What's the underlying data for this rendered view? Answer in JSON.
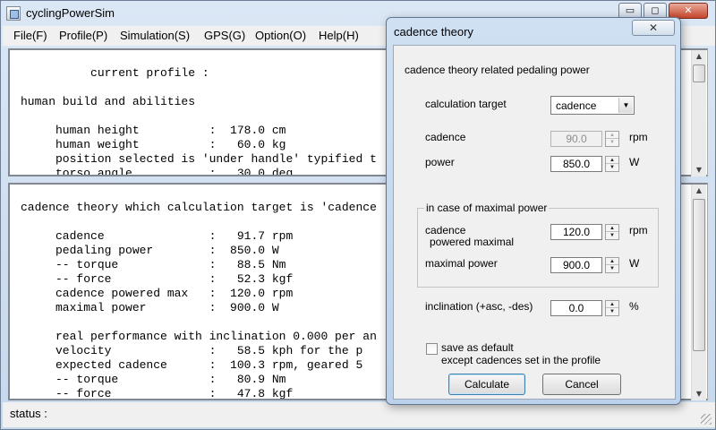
{
  "app": {
    "title": "cyclingPowerSim",
    "window_buttons": {
      "minimize": "▭",
      "maximize": "◻",
      "close": "✕"
    }
  },
  "menu": {
    "items": [
      {
        "label": "File(F)"
      },
      {
        "label": "Profile(P)"
      },
      {
        "label": "Simulation(S)"
      },
      {
        "label": "GPS(G)"
      },
      {
        "label": "Option(O)"
      },
      {
        "label": "Help(H)"
      }
    ]
  },
  "top_pane": {
    "lines": [
      "          current profile :",
      "",
      "human build and abilities",
      "",
      "     human height          :  178.0 cm",
      "     human weight          :   60.0 kg",
      "     position selected is 'under handle' typified t",
      "     torso angle           :   30.0 deg"
    ]
  },
  "bottom_pane": {
    "lines": [
      "cadence theory which calculation target is 'cadence",
      "",
      "     cadence               :   91.7 rpm",
      "     pedaling power        :  850.0 W",
      "     -- torque             :   88.5 Nm",
      "     -- force              :   52.3 kgf",
      "     cadence powered max   :  120.0 rpm",
      "     maximal power         :  900.0 W",
      "",
      "     real performance with inclination 0.000 per an",
      "     velocity              :   58.5 kph for the p",
      "     expected cadence      :  100.3 rpm, geared 5",
      "     -- torque             :   80.9 Nm",
      "     -- force              :   47.8 kgf"
    ]
  },
  "status": {
    "text": "status :"
  },
  "dialog": {
    "title": "cadence theory",
    "close_label": "✕",
    "heading": "cadence theory related pedaling power",
    "calc_target": {
      "label": "calculation target",
      "value": "cadence"
    },
    "cadence": {
      "label": "cadence",
      "value": "90.0",
      "unit": "rpm",
      "disabled": true
    },
    "power": {
      "label": "power",
      "value": "850.0",
      "unit": "W"
    },
    "group": {
      "legend": "in case of maximal power",
      "cadence_max": {
        "label_line1": "cadence",
        "label_line2": "powered maximal",
        "value": "120.0",
        "unit": "rpm"
      },
      "max_power": {
        "label": "maximal power",
        "value": "900.0",
        "unit": "W"
      }
    },
    "inclination": {
      "label": "inclination (+asc, -des)",
      "value": "0.0",
      "unit": "%"
    },
    "save_default": {
      "line1": "save as default",
      "line2": "except cadences set in the profile",
      "checked": false
    },
    "calculate_label": "Calculate",
    "cancel_label": "Cancel"
  }
}
